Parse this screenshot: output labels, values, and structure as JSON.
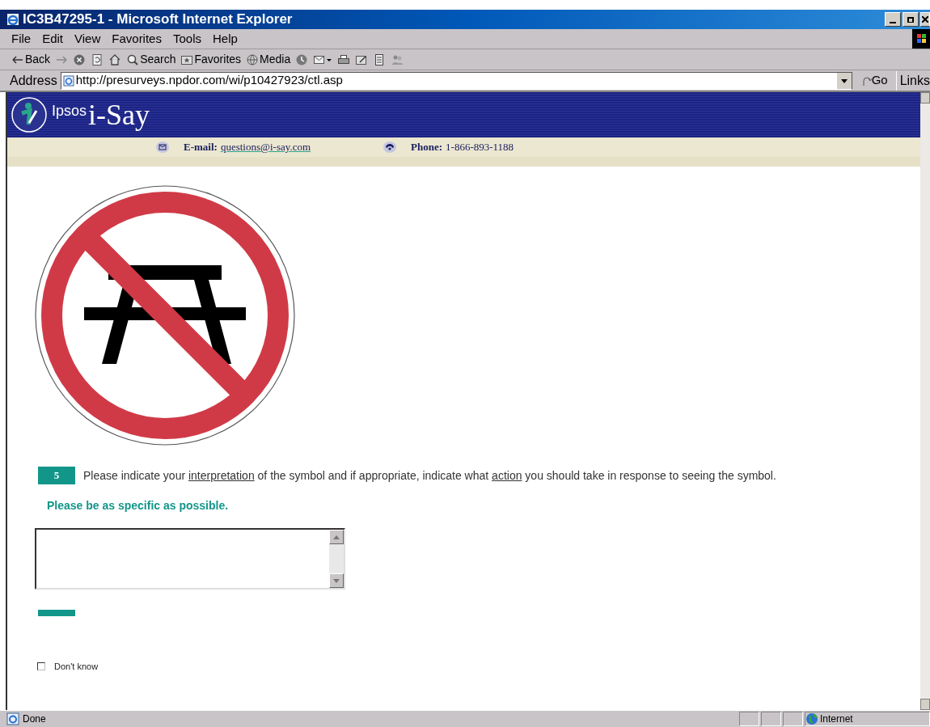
{
  "window": {
    "title": "IC3B47295-1 - Microsoft Internet Explorer"
  },
  "menu": [
    "File",
    "Edit",
    "View",
    "Favorites",
    "Tools",
    "Help"
  ],
  "toolbar": [
    {
      "kind": "back",
      "label": "Back"
    },
    {
      "kind": "forward"
    },
    {
      "kind": "stop"
    },
    {
      "kind": "refresh"
    },
    {
      "kind": "home"
    },
    {
      "kind": "search",
      "label": "Search"
    },
    {
      "kind": "favorites",
      "label": "Favorites"
    },
    {
      "kind": "media",
      "label": "Media"
    },
    {
      "kind": "history"
    },
    {
      "kind": "mail"
    },
    {
      "kind": "print"
    },
    {
      "kind": "edit"
    },
    {
      "kind": "discuss"
    },
    {
      "kind": "messenger"
    }
  ],
  "address": {
    "label": "Address",
    "value": "http://presurveys.npdor.com/wi/p10427923/ctl.asp",
    "go": "Go",
    "links": "Links"
  },
  "header": {
    "brand_small": "Ipsos",
    "brand": "i-Say",
    "email_label": "E-mail:",
    "email": "questions@i-say.com",
    "phone_label": "Phone:",
    "phone": "1-866-893-1188"
  },
  "question": {
    "number": "5",
    "segments": [
      {
        "text": "Please indicate your ",
        "underlined": false
      },
      {
        "text": "interpretation",
        "underlined": true
      },
      {
        "text": " of the symbol and if appropriate, indicate what ",
        "underlined": false
      },
      {
        "text": "action",
        "underlined": true
      },
      {
        "text": " you should take in response to seeing the symbol.",
        "underlined": false
      }
    ],
    "instruction": "Please be as specific as possible.",
    "dont_know": {
      "label": "Don't know",
      "checked": false
    }
  },
  "status_bar": {
    "text": "Done",
    "zone": "Internet"
  }
}
